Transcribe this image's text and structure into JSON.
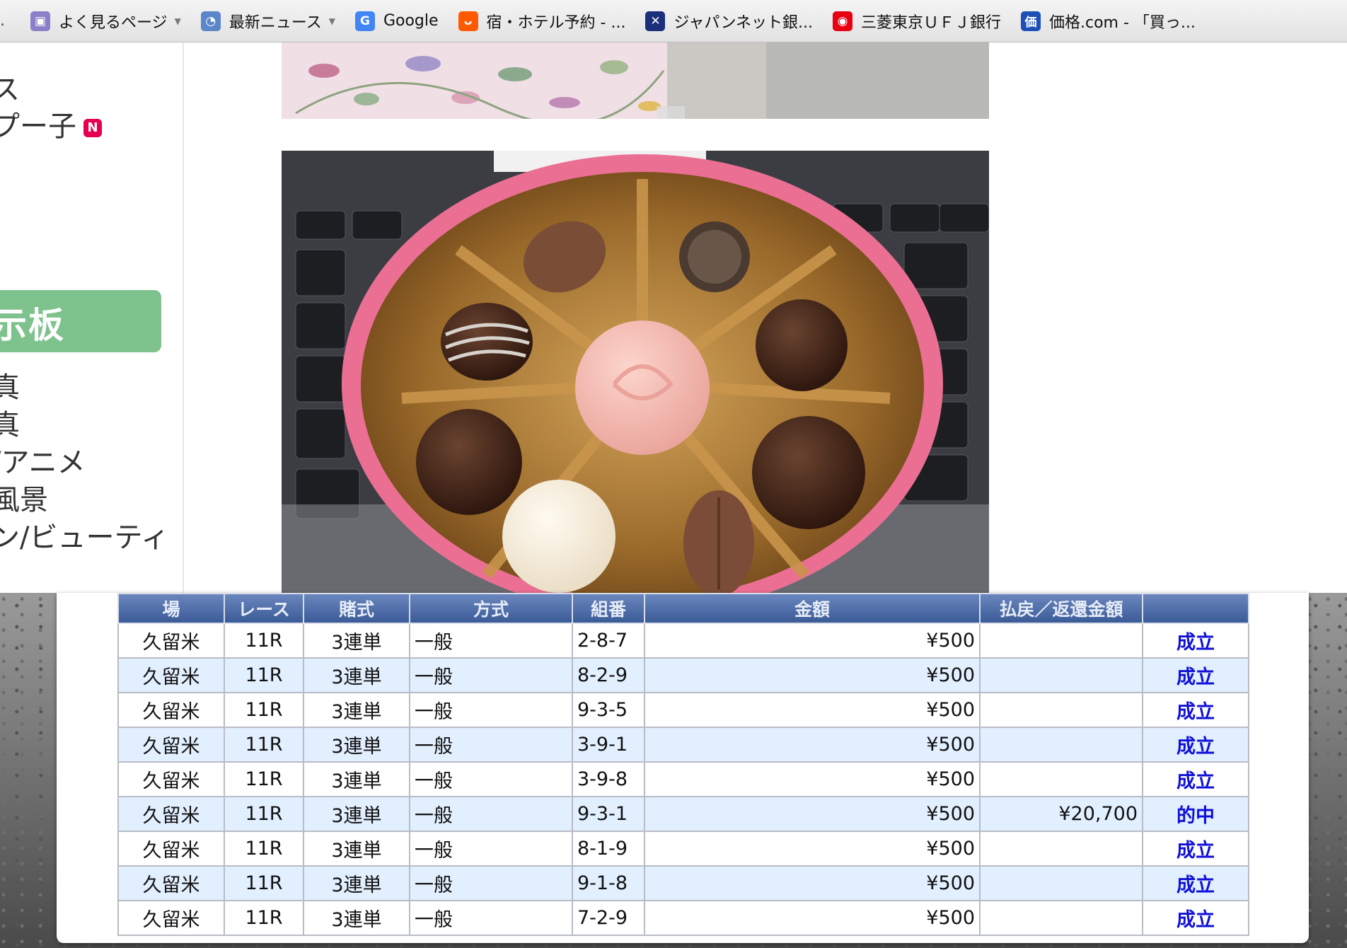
{
  "bookmarks": [
    {
      "label": "よく見るページ",
      "icon": "folder-icon",
      "dropdown": true,
      "color": "#8a7fc8"
    },
    {
      "label": "最新ニュース",
      "icon": "rss-icon",
      "dropdown": true,
      "color": "#5b86c9"
    },
    {
      "label": "Google",
      "icon": "google-icon",
      "dropdown": false,
      "color": "#4285f4"
    },
    {
      "label": "宿・ホテル予約 - ...",
      "icon": "hotel-icon",
      "dropdown": false,
      "color": "#ff5a00"
    },
    {
      "label": "ジャパンネット銀...",
      "icon": "bank-icon",
      "dropdown": false,
      "color": "#1b2f7a"
    },
    {
      "label": "三菱東京ＵＦＪ銀行",
      "icon": "mufg-icon",
      "dropdown": false,
      "color": "#e60012"
    },
    {
      "label": "価格.com - 「買っ...",
      "icon": "kakaku-icon",
      "dropdown": false,
      "color": "#1d4fb5"
    }
  ],
  "bookmark_leading": ".",
  "sidebar": {
    "items_top": [
      "ス",
      "プー子"
    ],
    "badge": "N",
    "green_label": "示板",
    "items_bottom": [
      "真",
      "真",
      "/アニメ",
      "風景",
      "ン/ビューティ"
    ]
  },
  "table": {
    "headers": [
      "場",
      "レース",
      "賭式",
      "方式",
      "組番",
      "金額",
      "払戻／返還金額",
      ""
    ],
    "rows": [
      [
        "久留米",
        "11R",
        "3連単",
        "一般",
        "2-8-7",
        "¥500",
        "",
        "成立"
      ],
      [
        "久留米",
        "11R",
        "3連単",
        "一般",
        "8-2-9",
        "¥500",
        "",
        "成立"
      ],
      [
        "久留米",
        "11R",
        "3連単",
        "一般",
        "9-3-5",
        "¥500",
        "",
        "成立"
      ],
      [
        "久留米",
        "11R",
        "3連単",
        "一般",
        "3-9-1",
        "¥500",
        "",
        "成立"
      ],
      [
        "久留米",
        "11R",
        "3連単",
        "一般",
        "3-9-8",
        "¥500",
        "",
        "成立"
      ],
      [
        "久留米",
        "11R",
        "3連単",
        "一般",
        "9-3-1",
        "¥500",
        "¥20,700",
        "的中"
      ],
      [
        "久留米",
        "11R",
        "3連単",
        "一般",
        "8-1-9",
        "¥500",
        "",
        "成立"
      ],
      [
        "久留米",
        "11R",
        "3連単",
        "一般",
        "9-1-8",
        "¥500",
        "",
        "成立"
      ],
      [
        "久留米",
        "11R",
        "3連単",
        "一般",
        "7-2-9",
        "¥500",
        "",
        "成立"
      ]
    ]
  },
  "colors": {
    "header_bg": "#3b5b98",
    "row_alt": "#e2efff",
    "status_text": "#1010d8",
    "sidebar_green": "#7ec28d"
  }
}
